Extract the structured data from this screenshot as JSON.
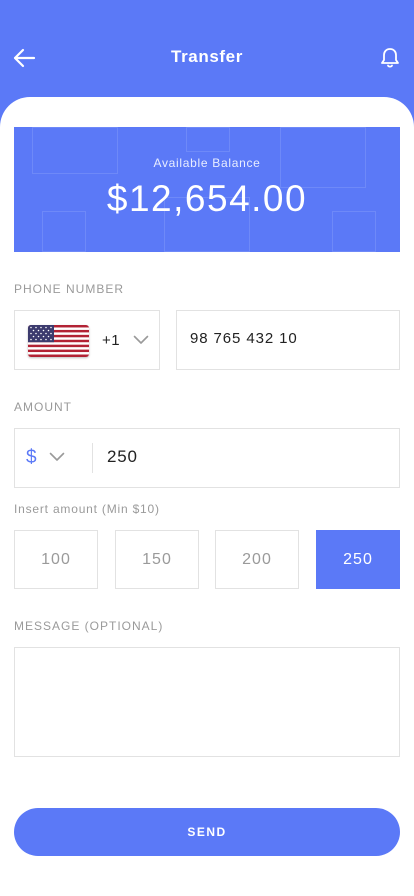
{
  "header": {
    "title": "Transfer",
    "back_icon": "arrow-left-icon",
    "notification_icon": "bell-icon"
  },
  "balance": {
    "label": "Available Balance",
    "amount": "$12,654.00"
  },
  "phone": {
    "section_label": "PHONE NUMBER",
    "country_flag": "us-flag-icon",
    "dial_code": "+1",
    "number": "98 765 432 10"
  },
  "amount": {
    "section_label": "AMOUNT",
    "currency_symbol": "$",
    "value": "250",
    "hint": "Insert amount (Min $10)",
    "presets": [
      "100",
      "150",
      "200",
      "250"
    ],
    "selected_preset": "250"
  },
  "message": {
    "section_label": "MESSAGE (OPTIONAL)",
    "value": ""
  },
  "actions": {
    "send_label": "SEND"
  },
  "colors": {
    "accent": "#5b79f7",
    "muted_text": "#9a9a9a",
    "border": "#e2e2e2"
  }
}
